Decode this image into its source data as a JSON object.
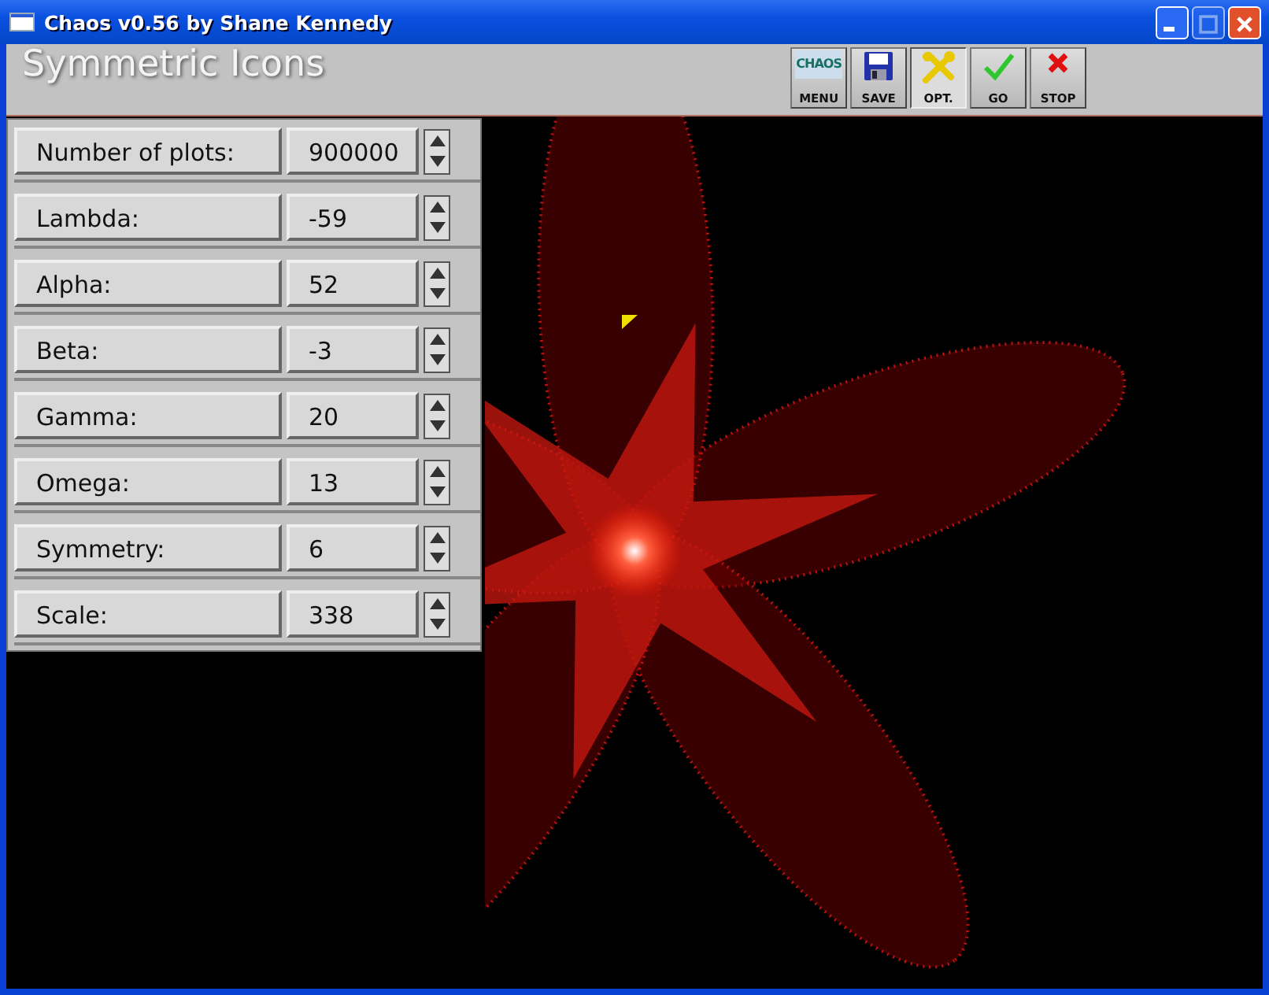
{
  "window": {
    "title": "Chaos v0.56 by Shane Kennedy"
  },
  "header": {
    "title": "Symmetric Icons"
  },
  "toolbar": [
    {
      "kind": "menu",
      "label": "MENU",
      "logo_text": "CHAOS",
      "selected": false
    },
    {
      "kind": "save",
      "label": "SAVE",
      "selected": false
    },
    {
      "kind": "options",
      "label": "OPT.",
      "selected": true
    },
    {
      "kind": "go",
      "label": "GO",
      "selected": false
    },
    {
      "kind": "stop",
      "label": "STOP",
      "selected": false
    }
  ],
  "parameters": [
    {
      "label": "Number of plots:",
      "value": "900000"
    },
    {
      "label": "Lambda:",
      "value": "-59"
    },
    {
      "label": "Alpha:",
      "value": "52"
    },
    {
      "label": "Beta:",
      "value": "-3"
    },
    {
      "label": "Gamma:",
      "value": "20"
    },
    {
      "label": "Omega:",
      "value": "13"
    },
    {
      "label": "Symmetry:",
      "value": "6"
    },
    {
      "label": "Scale:",
      "value": "338"
    }
  ]
}
